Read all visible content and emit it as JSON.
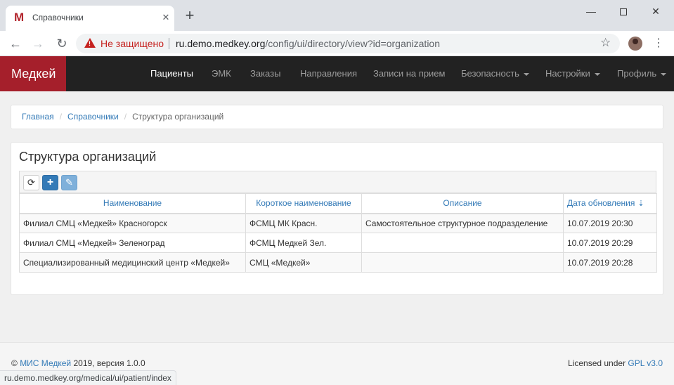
{
  "browser": {
    "tab_title": "Справочники",
    "tab_favicon": "M",
    "not_secure": "Не защищено",
    "url_host": "ru.demo.medkey.org",
    "url_path": "/config/ui/directory/view?id=organization",
    "status_url": "ru.demo.medkey.org/medical/ui/patient/index"
  },
  "navbar": {
    "brand": "Медкей",
    "brand_color": "#a51f2b",
    "items": [
      {
        "label": "Пациенты",
        "active": true
      },
      {
        "label": "ЭМК"
      },
      {
        "label": "Заказы"
      },
      {
        "label": "Направления"
      },
      {
        "label": "Записи на прием"
      },
      {
        "label": "Безопасность",
        "dropdown": true
      },
      {
        "label": "Настройки",
        "dropdown": true
      },
      {
        "label": "Профиль",
        "dropdown": true
      }
    ]
  },
  "breadcrumb": [
    "Главная",
    "Справочники",
    "Структура организаций"
  ],
  "panel": {
    "title": "Структура организаций",
    "toolbar": [
      "refresh-icon",
      "add-icon",
      "edit-icon"
    ]
  },
  "table": {
    "columns": [
      "Наименование",
      "Короткое наименование",
      "Описание",
      "Дата обновления"
    ],
    "sorted_column": "Дата обновления",
    "rows": [
      [
        "Филиал СМЦ «Медкей» Красногорск",
        "ФСМЦ МК Красн.",
        "Самостоятельное структурное подразделение",
        "10.07.2019 20:30"
      ],
      [
        "Филиал СМЦ «Медкей» Зеленоград",
        "ФСМЦ Медкей Зел.",
        "",
        "10.07.2019 20:29"
      ],
      [
        "Специализированный медицинский центр «Медкей»",
        "СМЦ «Медкей»",
        "",
        "10.07.2019 20:28"
      ]
    ]
  },
  "footer": {
    "copyright": "©",
    "link_text": "МИС Медкей",
    "version_text": "2019, версия 1.0.0",
    "license_text": "Licensed under",
    "license_link": "GPL v3.0"
  }
}
